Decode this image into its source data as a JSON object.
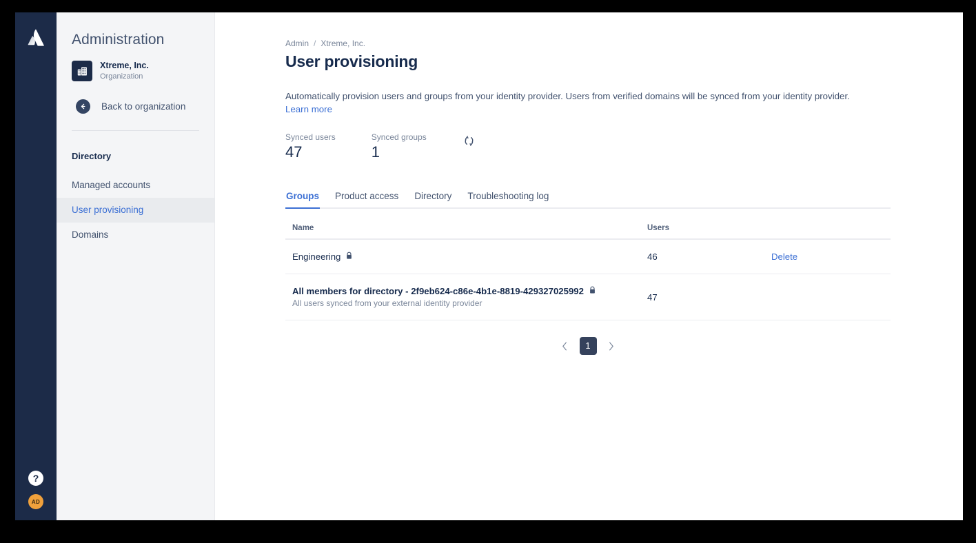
{
  "colors": {
    "rail_bg": "#1c2b48",
    "sidebar_bg": "#f4f5f7",
    "accent_link": "#3b6fd4",
    "text_primary": "#172b4d",
    "text_subtle": "#7a869a",
    "avatar_bg": "#f0a13c",
    "pager_selected_bg": "#35425c"
  },
  "rail": {
    "logo_icon": "atlassian-logo-icon",
    "help_icon": "help-icon",
    "help_label": "?",
    "avatar_initials": "AD"
  },
  "sidebar": {
    "title": "Administration",
    "org": {
      "icon": "building-icon",
      "name": "Xtreme, Inc.",
      "subtitle": "Organization"
    },
    "back": {
      "icon": "arrow-left-icon",
      "label": "Back to organization"
    },
    "section_heading": "Directory",
    "items": [
      {
        "label": "Managed accounts",
        "selected": false
      },
      {
        "label": "User provisioning",
        "selected": true
      },
      {
        "label": "Domains",
        "selected": false
      }
    ]
  },
  "main": {
    "breadcrumb": {
      "root": "Admin",
      "separator": "/",
      "current": "Xtreme, Inc."
    },
    "page_title": "User provisioning",
    "description": "Automatically provision users and groups from your identity provider. Users from verified domains will be synced from your identity provider.",
    "learn_more": "Learn more",
    "stats": [
      {
        "label": "Synced users",
        "value": "47"
      },
      {
        "label": "Synced groups",
        "value": "1"
      }
    ],
    "sync_icon": "refresh-sync-icon",
    "tabs": [
      {
        "label": "Groups",
        "active": true
      },
      {
        "label": "Product access",
        "active": false
      },
      {
        "label": "Directory",
        "active": false
      },
      {
        "label": "Troubleshooting log",
        "active": false
      }
    ],
    "table": {
      "headers": {
        "name": "Name",
        "users": "Users",
        "action": ""
      },
      "rows": [
        {
          "name": "Engineering",
          "bold": false,
          "lock_icon": "lock-icon",
          "subtitle": "",
          "users": "46",
          "action": "Delete"
        },
        {
          "name": "All members for directory - 2f9eb624-c86e-4b1e-8819-429327025992",
          "bold": true,
          "lock_icon": "lock-icon",
          "subtitle": "All users synced from your external identity provider",
          "users": "47",
          "action": ""
        }
      ]
    },
    "pagination": {
      "prev_icon": "chevron-left-icon",
      "next_icon": "chevron-right-icon",
      "current_page": "1"
    }
  }
}
